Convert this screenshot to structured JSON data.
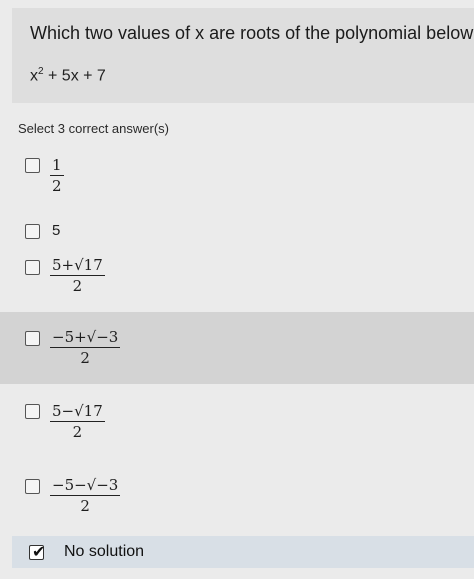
{
  "question": {
    "text": "Which two values of x are roots of the polynomial below?",
    "expression_base": "x",
    "expression_exp": "2",
    "expression_rest": " + 5x + 7"
  },
  "instructions": "Select 3 correct answer(s)",
  "options": [
    {
      "numerator": "1",
      "denominator": "2",
      "checked": false
    },
    {
      "label": "5",
      "checked": false
    },
    {
      "numerator": "5+√17",
      "denominator": "2",
      "checked": false
    },
    {
      "numerator": "−5+√−3",
      "denominator": "2",
      "checked": false
    },
    {
      "numerator": "5−√17",
      "denominator": "2",
      "checked": false
    },
    {
      "numerator": "−5−√−3",
      "denominator": "2",
      "checked": false
    },
    {
      "label": "No solution",
      "checked": true
    }
  ],
  "check_glyph": "✔"
}
